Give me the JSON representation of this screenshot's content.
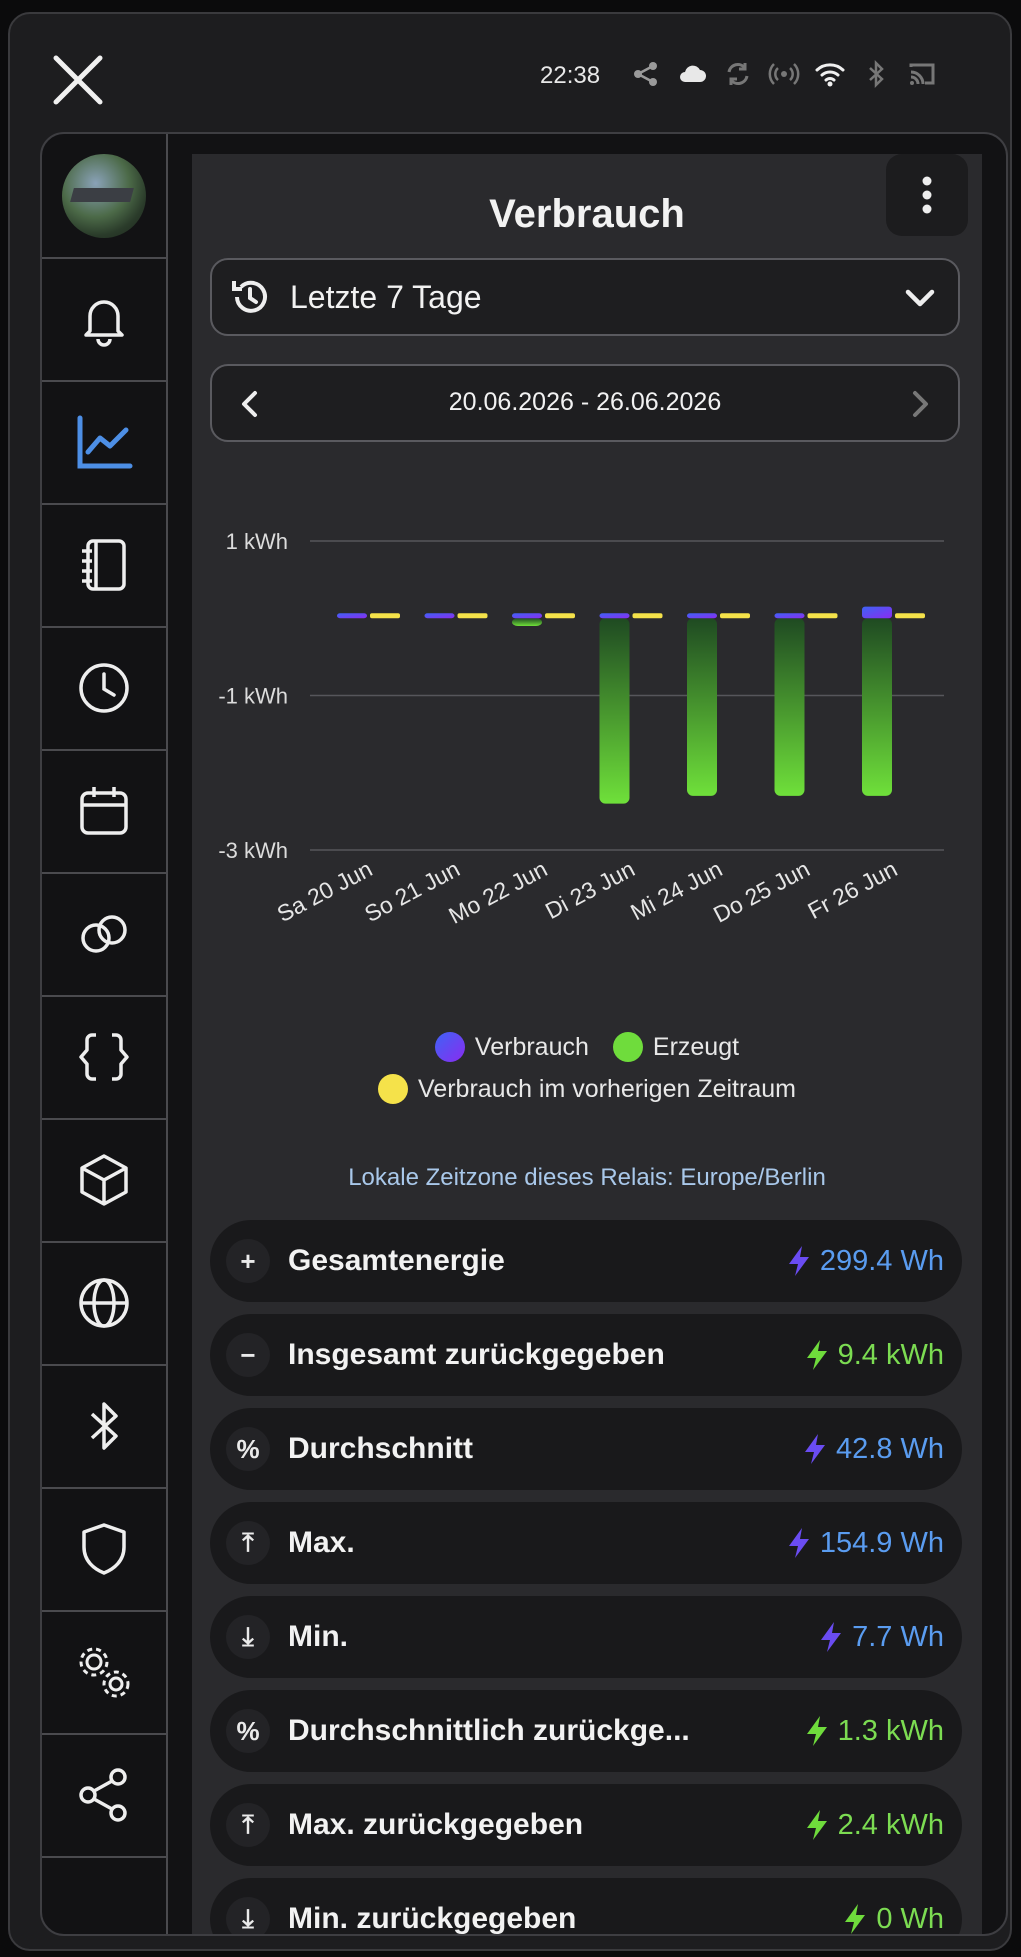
{
  "status_bar": {
    "time": "22:38",
    "icons": [
      "share-icon",
      "cloud-icon",
      "sync-icon",
      "broadcast-icon",
      "wifi-icon",
      "bluetooth-icon",
      "cast-icon"
    ]
  },
  "sidebar": {
    "items": [
      {
        "name": "avatar"
      },
      {
        "name": "bell-icon"
      },
      {
        "name": "chart-icon",
        "active": true
      },
      {
        "name": "notebook-icon"
      },
      {
        "name": "clock-icon"
      },
      {
        "name": "calendar-icon"
      },
      {
        "name": "link-icon"
      },
      {
        "name": "braces-icon"
      },
      {
        "name": "cube-icon"
      },
      {
        "name": "globe-icon"
      },
      {
        "name": "bluetooth-icon"
      },
      {
        "name": "shield-icon"
      },
      {
        "name": "gears-icon"
      },
      {
        "name": "share-icon"
      }
    ],
    "active_color": "#4d8fe6"
  },
  "header": {
    "title": "Verbrauch"
  },
  "period": {
    "selected": "Letzte 7 Tage"
  },
  "date_range": {
    "text": "20.06.2026 - 26.06.2026"
  },
  "chart_data": {
    "type": "bar",
    "categories": [
      "Sa 20 Jun",
      "So 21 Jun",
      "Mo 22 Jun",
      "Di 23 Jun",
      "Mi 24 Jun",
      "Do 25 Jun",
      "Fr 26 Jun"
    ],
    "y_ticks": [
      "1 kWh",
      "-1 kWh",
      "-3 kWh"
    ],
    "ylim": [
      -3,
      1
    ],
    "series": [
      {
        "name": "Verbrauch",
        "color": "#7a3cf5",
        "values": [
          0.01,
          0.01,
          0.01,
          0.0,
          0.0,
          0.0,
          0.15
        ]
      },
      {
        "name": "Erzeugt",
        "color": "#6fdc3c",
        "values": [
          0,
          0,
          -0.1,
          -2.4,
          -2.3,
          -2.3,
          -2.3
        ]
      },
      {
        "name": "Verbrauch im vorherigen Zeitraum",
        "color": "#f5e24a",
        "values": [
          0.0,
          0.0,
          0.0,
          0.0,
          0.0,
          0.0,
          0.0
        ]
      }
    ],
    "grid": true,
    "legend_position": "bottom"
  },
  "legend": {
    "items": [
      {
        "label": "Verbrauch",
        "color": "#7a3cf5"
      },
      {
        "label": "Erzeugt",
        "color": "#6fdc3c"
      },
      {
        "label": "Verbrauch im vorherigen Zeitraum",
        "color": "#f5e24a"
      }
    ]
  },
  "timezone_note": "Lokale Zeitzone dieses Relais: Europe/Berlin",
  "stats": [
    {
      "icon": "plus",
      "symbol": "+",
      "label": "Gesamtenergie",
      "value": "299.4 Wh",
      "kind": "blue"
    },
    {
      "icon": "minus",
      "symbol": "−",
      "label": "Insgesamt zurückgegeben",
      "value": "9.4 kWh",
      "kind": "green"
    },
    {
      "icon": "percent",
      "symbol": "%",
      "label": "Durchschnitt",
      "value": "42.8 Wh",
      "kind": "blue"
    },
    {
      "icon": "arrow-up-bar",
      "symbol": "⤒",
      "label": "Max.",
      "value": "154.9 Wh",
      "kind": "blue"
    },
    {
      "icon": "arrow-down-bar",
      "symbol": "⤓",
      "label": "Min.",
      "value": "7.7 Wh",
      "kind": "blue"
    },
    {
      "icon": "percent",
      "symbol": "%",
      "label": "Durchschnittlich zurückge...",
      "value": "1.3 kWh",
      "kind": "green"
    },
    {
      "icon": "arrow-up-bar",
      "symbol": "⤒",
      "label": "Max. zurückgegeben",
      "value": "2.4 kWh",
      "kind": "green"
    },
    {
      "icon": "arrow-down-bar",
      "symbol": "⤓",
      "label": "Min. zurückgegeben",
      "value": "0 Wh",
      "kind": "green"
    }
  ]
}
